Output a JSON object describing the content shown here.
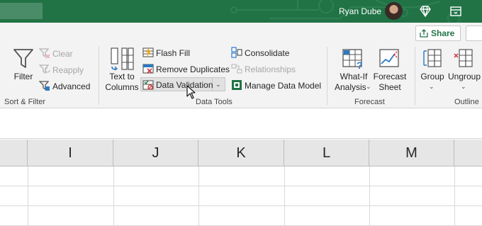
{
  "titlebar": {
    "user_name": "Ryan Dube",
    "bg_color": "#217346"
  },
  "ribbon": {
    "share_label": "Share",
    "sort_filter": {
      "filter_label": "Filter",
      "clear_label": "Clear",
      "reapply_label": "Reapply",
      "advanced_label": "Advanced",
      "group_label": "Sort & Filter"
    },
    "data_tools": {
      "text_to_columns_line1": "Text to",
      "text_to_columns_line2": "Columns",
      "flash_fill_label": "Flash Fill",
      "remove_duplicates_label": "Remove Duplicates",
      "data_validation_label": "Data Validation",
      "consolidate_label": "Consolidate",
      "relationships_label": "Relationships",
      "manage_data_model_label": "Manage Data Model",
      "group_label": "Data Tools"
    },
    "forecast": {
      "what_if_line1": "What-If",
      "what_if_line2": "Analysis",
      "forecast_sheet_line1": "Forecast",
      "forecast_sheet_line2": "Sheet",
      "group_label": "Forecast"
    },
    "outline": {
      "group_button_label": "Group",
      "ungroup_button_label": "Ungroup",
      "group_label": "Outline"
    }
  },
  "sheet": {
    "column_headers": [
      "I",
      "J",
      "K",
      "L",
      "M"
    ]
  }
}
